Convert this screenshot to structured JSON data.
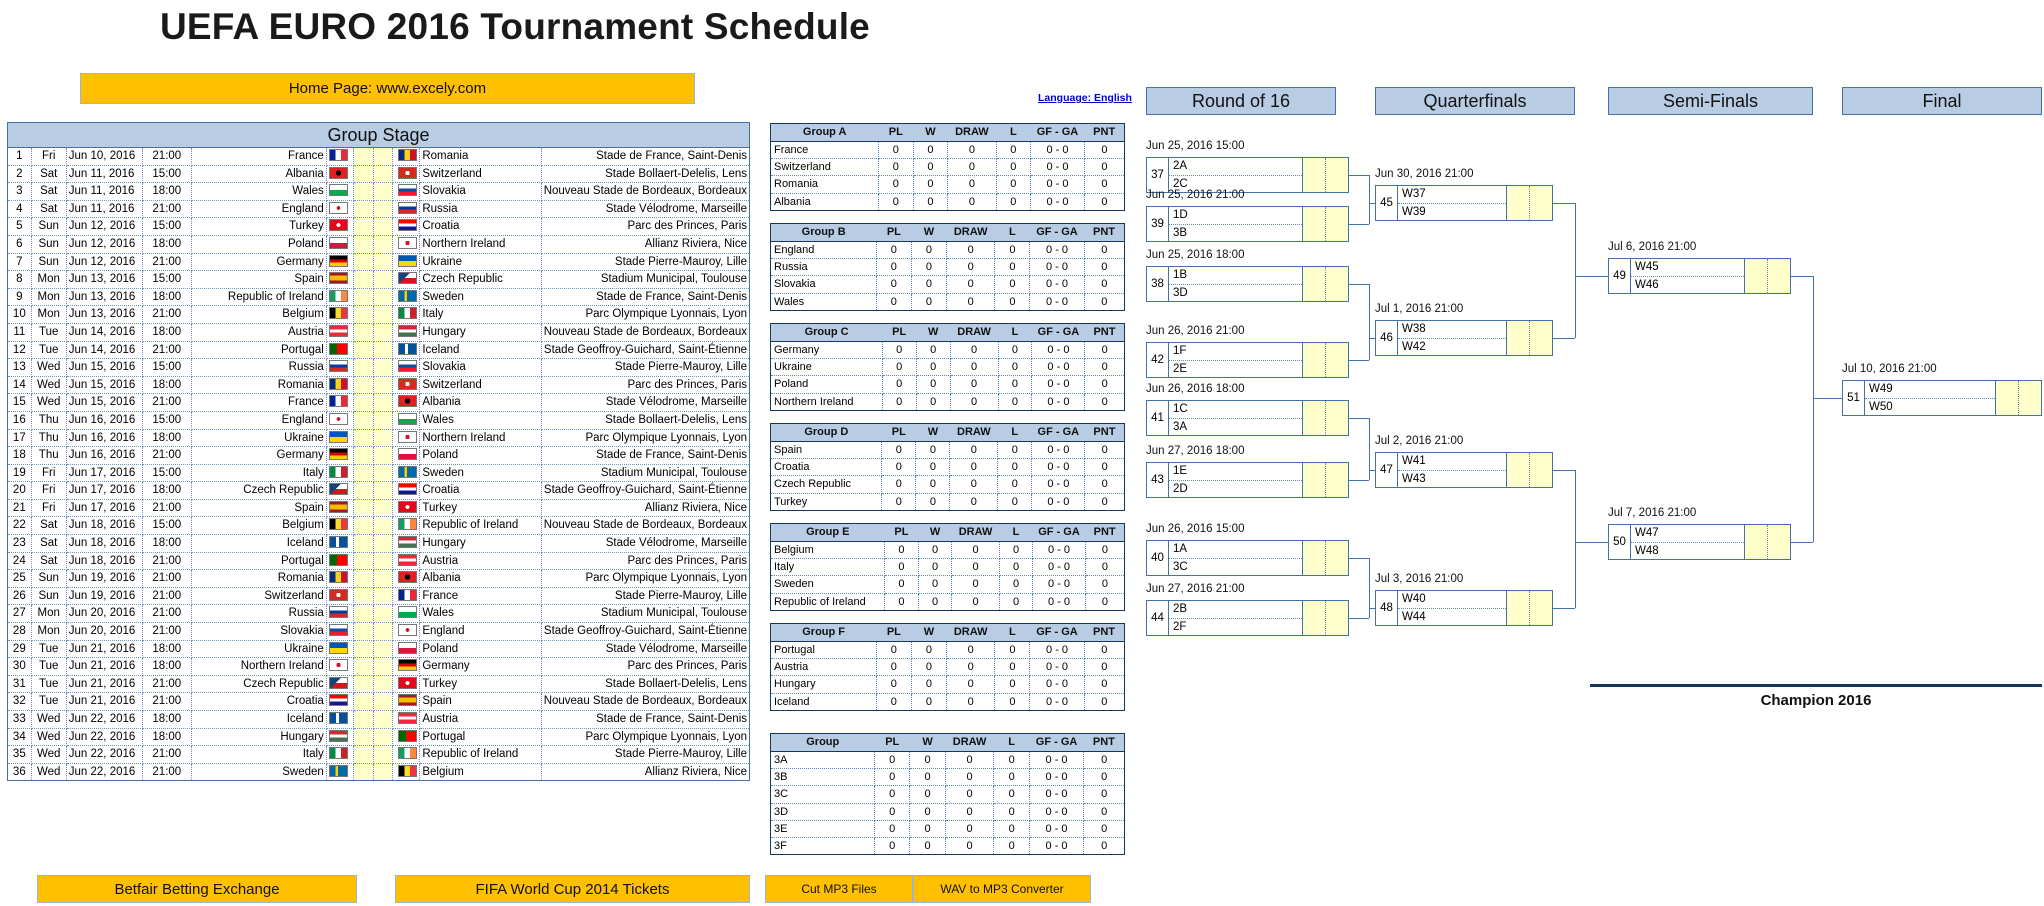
{
  "page": {
    "title": "UEFA EURO 2016 Tournament Schedule",
    "home_page": "Home Page: www.excely.com",
    "language_link": "Language: English",
    "group_stage_header": "Group Stage",
    "champion_label": "Champion 2016"
  },
  "footer_buttons": [
    {
      "label": "Betfair Betting Exchange"
    },
    {
      "label": "FIFA World Cup 2014 Tickets"
    },
    {
      "label": "Cut MP3 Files"
    },
    {
      "label": "WAV to MP3 Converter"
    }
  ],
  "bracket_headers": {
    "round_of_16": "Round of 16",
    "quarterfinals": "Quarterfinals",
    "semifinals": "Semi-Finals",
    "final": "Final"
  },
  "group_stage": {
    "matches": [
      {
        "no": "1",
        "day": "Fri",
        "date": "Jun 10, 2016",
        "time": "21:00",
        "home": "France",
        "away": "Romania",
        "venue": "Stade de France, Saint-Denis",
        "small": false
      },
      {
        "no": "2",
        "day": "Sat",
        "date": "Jun 11, 2016",
        "time": "15:00",
        "home": "Albania",
        "away": "Switzerland",
        "venue": "Stade Bollaert-Delelis, Lens",
        "small": false
      },
      {
        "no": "3",
        "day": "Sat",
        "date": "Jun 11, 2016",
        "time": "18:00",
        "home": "Wales",
        "away": "Slovakia",
        "venue": "Nouveau Stade de Bordeaux, Bordeaux",
        "small": true
      },
      {
        "no": "4",
        "day": "Sat",
        "date": "Jun 11, 2016",
        "time": "21:00",
        "home": "England",
        "away": "Russia",
        "venue": "Stade Vélodrome, Marseille",
        "small": false
      },
      {
        "no": "5",
        "day": "Sun",
        "date": "Jun 12, 2016",
        "time": "15:00",
        "home": "Turkey",
        "away": "Croatia",
        "venue": "Parc des Princes, Paris",
        "small": false
      },
      {
        "no": "6",
        "day": "Sun",
        "date": "Jun 12, 2016",
        "time": "18:00",
        "home": "Poland",
        "away": "Northern Ireland",
        "venue": "Allianz Riviera, Nice",
        "small": false
      },
      {
        "no": "7",
        "day": "Sun",
        "date": "Jun 12, 2016",
        "time": "21:00",
        "home": "Germany",
        "away": "Ukraine",
        "venue": "Stade Pierre-Mauroy, Lille",
        "small": false
      },
      {
        "no": "8",
        "day": "Mon",
        "date": "Jun 13, 2016",
        "time": "15:00",
        "home": "Spain",
        "away": "Czech Republic",
        "venue": "Stadium Municipal, Toulouse",
        "small": false
      },
      {
        "no": "9",
        "day": "Mon",
        "date": "Jun 13, 2016",
        "time": "18:00",
        "home": "Republic of Ireland",
        "away": "Sweden",
        "venue": "Stade de France, Saint-Denis",
        "small": false
      },
      {
        "no": "10",
        "day": "Mon",
        "date": "Jun 13, 2016",
        "time": "21:00",
        "home": "Belgium",
        "away": "Italy",
        "venue": "Parc Olympique Lyonnais, Lyon",
        "small": true
      },
      {
        "no": "11",
        "day": "Tue",
        "date": "Jun 14, 2016",
        "time": "18:00",
        "home": "Austria",
        "away": "Hungary",
        "venue": "Nouveau Stade de Bordeaux, Bordeaux",
        "small": true
      },
      {
        "no": "12",
        "day": "Tue",
        "date": "Jun 14, 2016",
        "time": "21:00",
        "home": "Portugal",
        "away": "Iceland",
        "venue": "Stade Geoffroy-Guichard, Saint-Étienne",
        "small": true
      },
      {
        "no": "13",
        "day": "Wed",
        "date": "Jun 15, 2016",
        "time": "15:00",
        "home": "Russia",
        "away": "Slovakia",
        "venue": "Stade Pierre-Mauroy, Lille",
        "small": false
      },
      {
        "no": "14",
        "day": "Wed",
        "date": "Jun 15, 2016",
        "time": "18:00",
        "home": "Romania",
        "away": "Switzerland",
        "venue": "Parc des Princes, Paris",
        "small": false
      },
      {
        "no": "15",
        "day": "Wed",
        "date": "Jun 15, 2016",
        "time": "21:00",
        "home": "France",
        "away": "Albania",
        "venue": "Stade Vélodrome, Marseille",
        "small": false
      },
      {
        "no": "16",
        "day": "Thu",
        "date": "Jun 16, 2016",
        "time": "15:00",
        "home": "England",
        "away": "Wales",
        "venue": "Stade Bollaert-Delelis, Lens",
        "small": false
      },
      {
        "no": "17",
        "day": "Thu",
        "date": "Jun 16, 2016",
        "time": "18:00",
        "home": "Ukraine",
        "away": "Northern Ireland",
        "venue": "Parc Olympique Lyonnais, Lyon",
        "small": true
      },
      {
        "no": "18",
        "day": "Thu",
        "date": "Jun 16, 2016",
        "time": "21:00",
        "home": "Germany",
        "away": "Poland",
        "venue": "Stade de France, Saint-Denis",
        "small": false
      },
      {
        "no": "19",
        "day": "Fri",
        "date": "Jun 17, 2016",
        "time": "15:00",
        "home": "Italy",
        "away": "Sweden",
        "venue": "Stadium Municipal, Toulouse",
        "small": false
      },
      {
        "no": "20",
        "day": "Fri",
        "date": "Jun 17, 2016",
        "time": "18:00",
        "home": "Czech Republic",
        "away": "Croatia",
        "venue": "Stade Geoffroy-Guichard, Saint-Étienne",
        "small": true
      },
      {
        "no": "21",
        "day": "Fri",
        "date": "Jun 17, 2016",
        "time": "21:00",
        "home": "Spain",
        "away": "Turkey",
        "venue": "Allianz Riviera, Nice",
        "small": false
      },
      {
        "no": "22",
        "day": "Sat",
        "date": "Jun 18, 2016",
        "time": "15:00",
        "home": "Belgium",
        "away": "Republic of Ireland",
        "venue": "Nouveau Stade de Bordeaux, Bordeaux",
        "small": true
      },
      {
        "no": "23",
        "day": "Sat",
        "date": "Jun 18, 2016",
        "time": "18:00",
        "home": "Iceland",
        "away": "Hungary",
        "venue": "Stade Vélodrome, Marseille",
        "small": false
      },
      {
        "no": "24",
        "day": "Sat",
        "date": "Jun 18, 2016",
        "time": "21:00",
        "home": "Portugal",
        "away": "Austria",
        "venue": "Parc des Princes, Paris",
        "small": false
      },
      {
        "no": "25",
        "day": "Sun",
        "date": "Jun 19, 2016",
        "time": "21:00",
        "home": "Romania",
        "away": "Albania",
        "venue": "Parc Olympique Lyonnais, Lyon",
        "small": true
      },
      {
        "no": "26",
        "day": "Sun",
        "date": "Jun 19, 2016",
        "time": "21:00",
        "home": "Switzerland",
        "away": "France",
        "venue": "Stade Pierre-Mauroy, Lille",
        "small": false
      },
      {
        "no": "27",
        "day": "Mon",
        "date": "Jun 20, 2016",
        "time": "21:00",
        "home": "Russia",
        "away": "Wales",
        "venue": "Stadium Municipal, Toulouse",
        "small": false
      },
      {
        "no": "28",
        "day": "Mon",
        "date": "Jun 20, 2016",
        "time": "21:00",
        "home": "Slovakia",
        "away": "England",
        "venue": "Stade Geoffroy-Guichard, Saint-Étienne",
        "small": true
      },
      {
        "no": "29",
        "day": "Tue",
        "date": "Jun 21, 2016",
        "time": "18:00",
        "home": "Ukraine",
        "away": "Poland",
        "venue": "Stade Vélodrome, Marseille",
        "small": false
      },
      {
        "no": "30",
        "day": "Tue",
        "date": "Jun 21, 2016",
        "time": "18:00",
        "home": "Northern Ireland",
        "away": "Germany",
        "venue": "Parc des Princes, Paris",
        "small": false
      },
      {
        "no": "31",
        "day": "Tue",
        "date": "Jun 21, 2016",
        "time": "21:00",
        "home": "Czech Republic",
        "away": "Turkey",
        "venue": "Stade Bollaert-Delelis, Lens",
        "small": false
      },
      {
        "no": "32",
        "day": "Tue",
        "date": "Jun 21, 2016",
        "time": "21:00",
        "home": "Croatia",
        "away": "Spain",
        "venue": "Nouveau Stade de Bordeaux, Bordeaux",
        "small": true
      },
      {
        "no": "33",
        "day": "Wed",
        "date": "Jun 22, 2016",
        "time": "18:00",
        "home": "Iceland",
        "away": "Austria",
        "venue": "Stade de France, Saint-Denis",
        "small": false
      },
      {
        "no": "34",
        "day": "Wed",
        "date": "Jun 22, 2016",
        "time": "18:00",
        "home": "Hungary",
        "away": "Portugal",
        "venue": "Parc Olympique Lyonnais, Lyon",
        "small": true
      },
      {
        "no": "35",
        "day": "Wed",
        "date": "Jun 22, 2016",
        "time": "21:00",
        "home": "Italy",
        "away": "Republic of Ireland",
        "venue": "Stade Pierre-Mauroy, Lille",
        "small": false
      },
      {
        "no": "36",
        "day": "Wed",
        "date": "Jun 22, 2016",
        "time": "21:00",
        "home": "Sweden",
        "away": "Belgium",
        "venue": "Allianz Riviera, Nice",
        "small": false
      }
    ]
  },
  "standings": {
    "columns": [
      "PL",
      "W",
      "DRAW",
      "L",
      "GF - GA",
      "PNT"
    ],
    "tables": [
      {
        "name": "Group A",
        "rows": [
          {
            "team": "France",
            "pl": "0",
            "w": "0",
            "draw": "0",
            "l": "0",
            "gfga": "0 - 0",
            "pnt": "0"
          },
          {
            "team": "Switzerland",
            "pl": "0",
            "w": "0",
            "draw": "0",
            "l": "0",
            "gfga": "0 - 0",
            "pnt": "0"
          },
          {
            "team": "Romania",
            "pl": "0",
            "w": "0",
            "draw": "0",
            "l": "0",
            "gfga": "0 - 0",
            "pnt": "0"
          },
          {
            "team": "Albania",
            "pl": "0",
            "w": "0",
            "draw": "0",
            "l": "0",
            "gfga": "0 - 0",
            "pnt": "0"
          }
        ]
      },
      {
        "name": "Group B",
        "rows": [
          {
            "team": "England",
            "pl": "0",
            "w": "0",
            "draw": "0",
            "l": "0",
            "gfga": "0 - 0",
            "pnt": "0"
          },
          {
            "team": "Russia",
            "pl": "0",
            "w": "0",
            "draw": "0",
            "l": "0",
            "gfga": "0 - 0",
            "pnt": "0"
          },
          {
            "team": "Slovakia",
            "pl": "0",
            "w": "0",
            "draw": "0",
            "l": "0",
            "gfga": "0 - 0",
            "pnt": "0"
          },
          {
            "team": "Wales",
            "pl": "0",
            "w": "0",
            "draw": "0",
            "l": "0",
            "gfga": "0 - 0",
            "pnt": "0"
          }
        ]
      },
      {
        "name": "Group C",
        "rows": [
          {
            "team": "Germany",
            "pl": "0",
            "w": "0",
            "draw": "0",
            "l": "0",
            "gfga": "0 - 0",
            "pnt": "0"
          },
          {
            "team": "Ukraine",
            "pl": "0",
            "w": "0",
            "draw": "0",
            "l": "0",
            "gfga": "0 - 0",
            "pnt": "0"
          },
          {
            "team": "Poland",
            "pl": "0",
            "w": "0",
            "draw": "0",
            "l": "0",
            "gfga": "0 - 0",
            "pnt": "0"
          },
          {
            "team": "Northern Ireland",
            "pl": "0",
            "w": "0",
            "draw": "0",
            "l": "0",
            "gfga": "0 - 0",
            "pnt": "0"
          }
        ]
      },
      {
        "name": "Group D",
        "rows": [
          {
            "team": "Spain",
            "pl": "0",
            "w": "0",
            "draw": "0",
            "l": "0",
            "gfga": "0 - 0",
            "pnt": "0"
          },
          {
            "team": "Croatia",
            "pl": "0",
            "w": "0",
            "draw": "0",
            "l": "0",
            "gfga": "0 - 0",
            "pnt": "0"
          },
          {
            "team": "Czech Republic",
            "pl": "0",
            "w": "0",
            "draw": "0",
            "l": "0",
            "gfga": "0 - 0",
            "pnt": "0"
          },
          {
            "team": "Turkey",
            "pl": "0",
            "w": "0",
            "draw": "0",
            "l": "0",
            "gfga": "0 - 0",
            "pnt": "0"
          }
        ]
      },
      {
        "name": "Group E",
        "rows": [
          {
            "team": "Belgium",
            "pl": "0",
            "w": "0",
            "draw": "0",
            "l": "0",
            "gfga": "0 - 0",
            "pnt": "0"
          },
          {
            "team": "Italy",
            "pl": "0",
            "w": "0",
            "draw": "0",
            "l": "0",
            "gfga": "0 - 0",
            "pnt": "0"
          },
          {
            "team": "Sweden",
            "pl": "0",
            "w": "0",
            "draw": "0",
            "l": "0",
            "gfga": "0 - 0",
            "pnt": "0"
          },
          {
            "team": "Republic of Ireland",
            "pl": "0",
            "w": "0",
            "draw": "0",
            "l": "0",
            "gfga": "0 - 0",
            "pnt": "0"
          }
        ]
      },
      {
        "name": "Group F",
        "rows": [
          {
            "team": "Portugal",
            "pl": "0",
            "w": "0",
            "draw": "0",
            "l": "0",
            "gfga": "0 - 0",
            "pnt": "0"
          },
          {
            "team": "Austria",
            "pl": "0",
            "w": "0",
            "draw": "0",
            "l": "0",
            "gfga": "0 - 0",
            "pnt": "0"
          },
          {
            "team": "Hungary",
            "pl": "0",
            "w": "0",
            "draw": "0",
            "l": "0",
            "gfga": "0 - 0",
            "pnt": "0"
          },
          {
            "team": "Iceland",
            "pl": "0",
            "w": "0",
            "draw": "0",
            "l": "0",
            "gfga": "0 - 0",
            "pnt": "0"
          }
        ]
      },
      {
        "name": "Group",
        "rows": [
          {
            "team": "3A",
            "pl": "0",
            "w": "0",
            "draw": "0",
            "l": "0",
            "gfga": "0 - 0",
            "pnt": "0"
          },
          {
            "team": "3B",
            "pl": "0",
            "w": "0",
            "draw": "0",
            "l": "0",
            "gfga": "0 - 0",
            "pnt": "0"
          },
          {
            "team": "3C",
            "pl": "0",
            "w": "0",
            "draw": "0",
            "l": "0",
            "gfga": "0 - 0",
            "pnt": "0"
          },
          {
            "team": "3D",
            "pl": "0",
            "w": "0",
            "draw": "0",
            "l": "0",
            "gfga": "0 - 0",
            "pnt": "0"
          },
          {
            "team": "3E",
            "pl": "0",
            "w": "0",
            "draw": "0",
            "l": "0",
            "gfga": "0 - 0",
            "pnt": "0"
          },
          {
            "team": "3F",
            "pl": "0",
            "w": "0",
            "draw": "0",
            "l": "0",
            "gfga": "0 - 0",
            "pnt": "0"
          }
        ]
      }
    ]
  },
  "bracket": {
    "round_of_16": [
      {
        "num": "37",
        "datetime": "Jun 25, 2016   15:00",
        "t1": "2A",
        "t2": "2C"
      },
      {
        "num": "39",
        "datetime": "Jun 25, 2016   21:00",
        "t1": "1D",
        "t2": "3B"
      },
      {
        "num": "38",
        "datetime": "Jun 25, 2016   18:00",
        "t1": "1B",
        "t2": "3D"
      },
      {
        "num": "42",
        "datetime": "Jun 26, 2016   21:00",
        "t1": "1F",
        "t2": "2E"
      },
      {
        "num": "41",
        "datetime": "Jun 26, 2016   18:00",
        "t1": "1C",
        "t2": "3A"
      },
      {
        "num": "43",
        "datetime": "Jun 27, 2016   18:00",
        "t1": "1E",
        "t2": "2D"
      },
      {
        "num": "40",
        "datetime": "Jun 26, 2016   15:00",
        "t1": "1A",
        "t2": "3C"
      },
      {
        "num": "44",
        "datetime": "Jun 27, 2016   21:00",
        "t1": "2B",
        "t2": "2F"
      }
    ],
    "quarterfinals": [
      {
        "num": "45",
        "datetime": "Jun 30, 2016   21:00",
        "t1": "W37",
        "t2": "W39"
      },
      {
        "num": "46",
        "datetime": "Jul 1, 2016   21:00",
        "t1": "W38",
        "t2": "W42"
      },
      {
        "num": "47",
        "datetime": "Jul 2, 2016   21:00",
        "t1": "W41",
        "t2": "W43"
      },
      {
        "num": "48",
        "datetime": "Jul 3, 2016   21:00",
        "t1": "W40",
        "t2": "W44"
      }
    ],
    "semifinals": [
      {
        "num": "49",
        "datetime": "Jul 6, 2016   21:00",
        "t1": "W45",
        "t2": "W46"
      },
      {
        "num": "50",
        "datetime": "Jul 7, 2016   21:00",
        "t1": "W47",
        "t2": "W48"
      }
    ],
    "final": [
      {
        "num": "51",
        "datetime": "Jul 10, 2016   21:00",
        "t1": "W49",
        "t2": "W50"
      }
    ]
  },
  "colors": {
    "accent_orange": "#FFC000",
    "header_blue": "#B8CCE4",
    "border_blue": "#4472A8",
    "score_yellow": "#FFFFCC",
    "link_blue": "#0000CC"
  }
}
